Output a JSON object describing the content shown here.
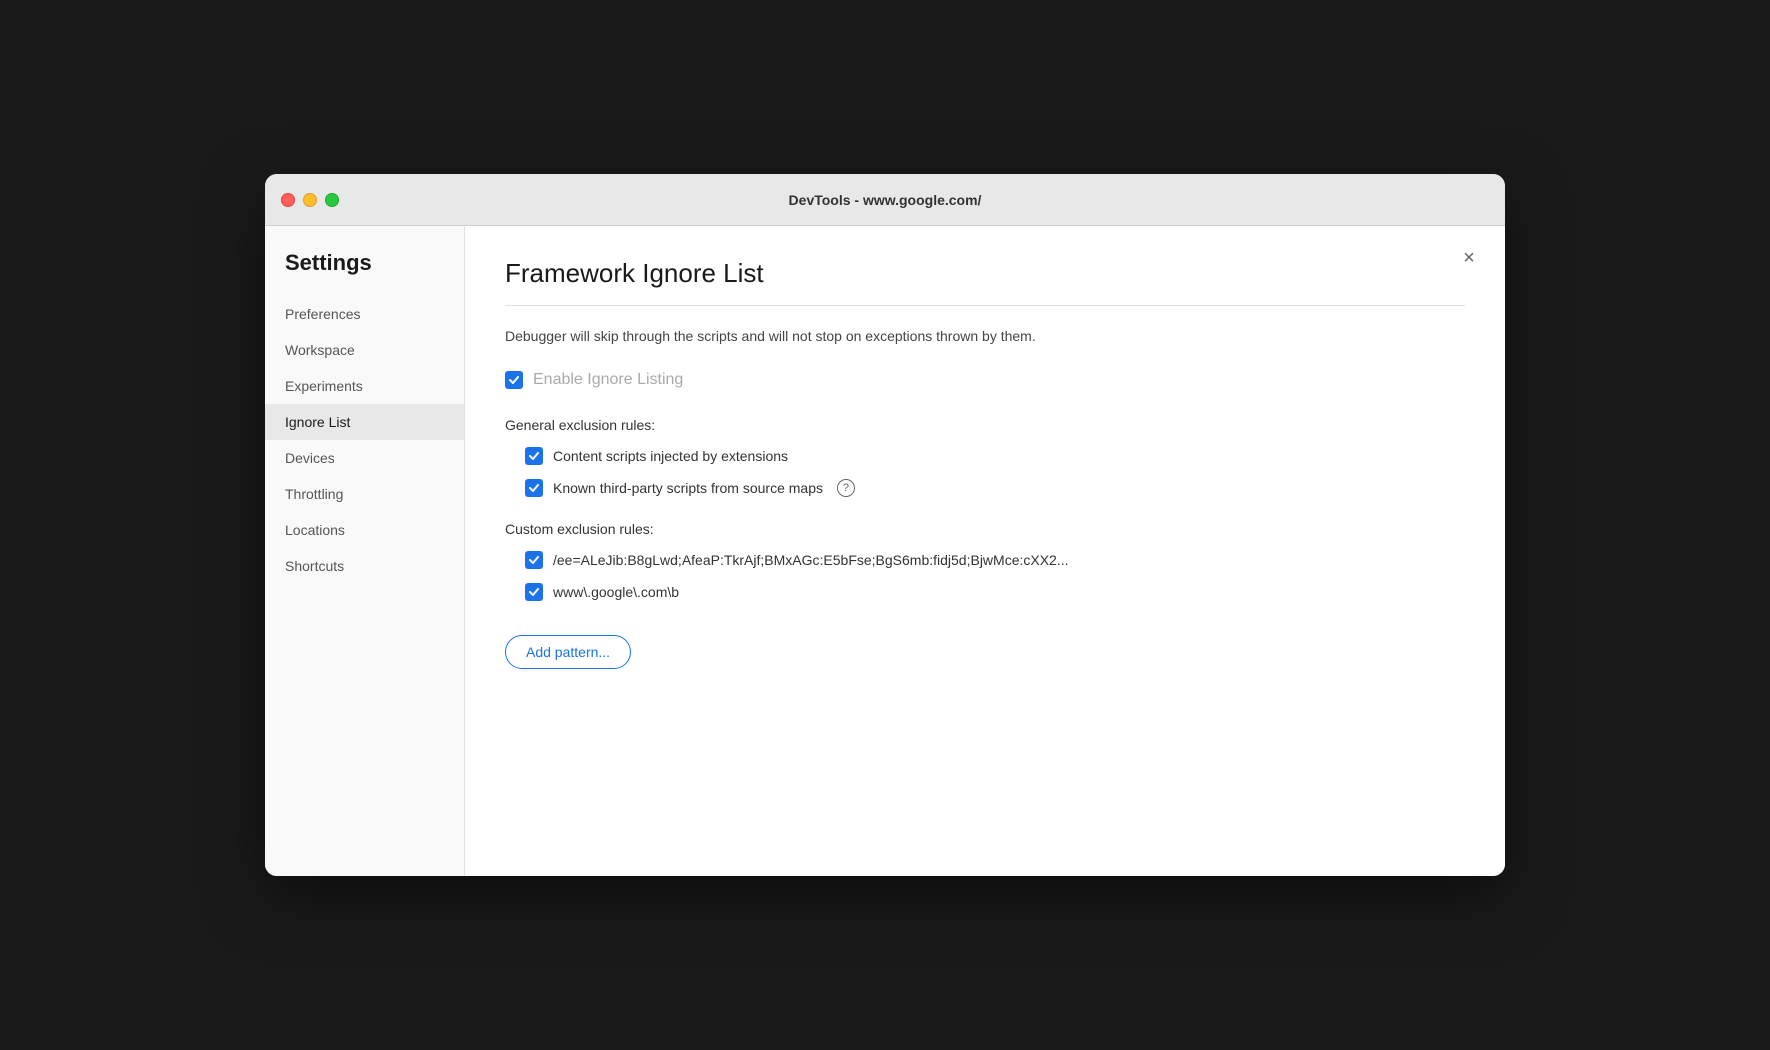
{
  "titlebar": {
    "title": "DevTools - www.google.com/"
  },
  "sidebar": {
    "heading": "Settings",
    "items": [
      {
        "id": "preferences",
        "label": "Preferences",
        "active": false
      },
      {
        "id": "workspace",
        "label": "Workspace",
        "active": false
      },
      {
        "id": "experiments",
        "label": "Experiments",
        "active": false
      },
      {
        "id": "ignore-list",
        "label": "Ignore List",
        "active": true
      },
      {
        "id": "devices",
        "label": "Devices",
        "active": false
      },
      {
        "id": "throttling",
        "label": "Throttling",
        "active": false
      },
      {
        "id": "locations",
        "label": "Locations",
        "active": false
      },
      {
        "id": "shortcuts",
        "label": "Shortcuts",
        "active": false
      }
    ]
  },
  "main": {
    "page_title": "Framework Ignore List",
    "description": "Debugger will skip through the scripts and will not stop on exceptions thrown by them.",
    "enable_ignore_listing_label": "Enable Ignore Listing",
    "general_exclusion_label": "General exclusion rules:",
    "general_rules": [
      {
        "id": "content-scripts",
        "label": "Content scripts injected by extensions",
        "checked": true,
        "has_info": false
      },
      {
        "id": "third-party-scripts",
        "label": "Known third-party scripts from source maps",
        "checked": true,
        "has_info": true
      }
    ],
    "custom_exclusion_label": "Custom exclusion rules:",
    "custom_rules": [
      {
        "id": "rule1",
        "label": "/ee=ALeJib:B8gLwd;AfeaP:TkrAjf;BMxAGc:E5bFse;BgS6mb:fidj5d;BjwMce:cXX2...",
        "checked": true
      },
      {
        "id": "rule2",
        "label": "www\\.google\\.com\\b",
        "checked": true
      }
    ],
    "add_pattern_label": "Add pattern...",
    "close_label": "×"
  }
}
